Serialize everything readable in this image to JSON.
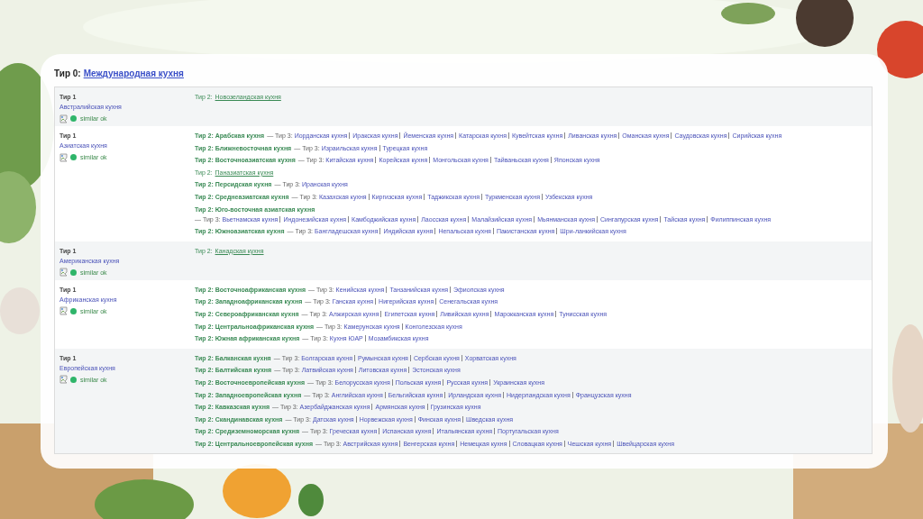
{
  "tier0": {
    "label": "Тир 0:",
    "name": "Международная кухня"
  },
  "rows": [
    {
      "tier_label": "Тир 1",
      "name": "Австралийская кухня",
      "status": "similar ok",
      "subgroups": [
        {
          "kind": "link",
          "label": "Тир 2:",
          "name": "Новозеландская кухня"
        }
      ]
    },
    {
      "tier_label": "Тир 1",
      "name": "Азиатская кухня",
      "status": "similar ok",
      "subgroups": [
        {
          "kind": "group",
          "label": "Тир 2:",
          "name": "Арабская кухня",
          "tier3_label": "— Тир 3:",
          "items": [
            "Иорданская кухня",
            "Иракская кухня",
            "Йеменская кухня",
            "Катарская кухня",
            "Кувейтская кухня",
            "Ливанская кухня",
            "Оманская кухня",
            "Саудовская кухня",
            "Сирийская кухня"
          ]
        },
        {
          "kind": "group",
          "label": "Тир 2:",
          "name": "Ближневосточная кухня",
          "tier3_label": "— Тир 3:",
          "items": [
            "Израильская кухня",
            "Турецкая кухня"
          ]
        },
        {
          "kind": "group",
          "label": "Тир 2:",
          "name": "Восточноазиатская кухня",
          "tier3_label": "— Тир 3:",
          "items": [
            "Китайская кухня",
            "Корейская кухня",
            "Монгольская кухня",
            "Тайваньская кухня",
            "Японская кухня"
          ]
        },
        {
          "kind": "link",
          "label": "Тир 2:",
          "name": "Паназиатская кухня"
        },
        {
          "kind": "group",
          "label": "Тир 2:",
          "name": "Персидская кухня",
          "tier3_label": "— Тир 3:",
          "items": [
            "Иранская кухня"
          ]
        },
        {
          "kind": "group",
          "label": "Тир 2:",
          "name": "Среднеазиатская кухня",
          "tier3_label": "— Тир 3:",
          "items": [
            "Казахская кухня",
            "Киргизская кухня",
            "Таджикская кухня",
            "Туркменская кухня",
            "Узбекская кухня"
          ]
        },
        {
          "kind": "group",
          "label": "Тир 2:",
          "name": "Юго-восточная азиатская кухня",
          "tier3_label": "— Тир 3:",
          "items": [
            "Вьетнамская кухня",
            "Индонезийская кухня",
            "Камбоджийская кухня",
            "Лаосская кухня",
            "Малайзийская кухня",
            "Мьянманская кухня",
            "Сингапурская кухня",
            "Тайская кухня",
            "Филиппинская кухня"
          ]
        },
        {
          "kind": "group",
          "label": "Тир 2:",
          "name": "Южноазиатская кухня",
          "tier3_label": "— Тир 3:",
          "items": [
            "Бангладешская кухня",
            "Индийская кухня",
            "Непальская кухня",
            "Пакистанская кухня",
            "Шри-ланкийская кухня"
          ]
        }
      ]
    },
    {
      "tier_label": "Тир 1",
      "name": "Американская кухня",
      "status": "similar ok",
      "subgroups": [
        {
          "kind": "link",
          "label": "Тир 2:",
          "name": "Канадская кухня"
        }
      ]
    },
    {
      "tier_label": "Тир 1",
      "name": "Африканская кухня",
      "status": "similar ok",
      "subgroups": [
        {
          "kind": "group",
          "label": "Тир 2:",
          "name": "Восточноафриканская кухня",
          "tier3_label": "— Тир 3:",
          "items": [
            "Кенийская кухня",
            "Танзанийская кухня",
            "Эфиопская кухня"
          ]
        },
        {
          "kind": "group",
          "label": "Тир 2:",
          "name": "Западноафриканская кухня",
          "tier3_label": "— Тир 3:",
          "items": [
            "Ганская кухня",
            "Нигерийская кухня",
            "Сенегальская кухня"
          ]
        },
        {
          "kind": "group",
          "label": "Тир 2:",
          "name": "Североафриканская кухня",
          "tier3_label": "— Тир 3:",
          "items": [
            "Алжирская кухня",
            "Египетская кухня",
            "Ливийская кухня",
            "Марокканская кухня",
            "Тунисская кухня"
          ]
        },
        {
          "kind": "group",
          "label": "Тир 2:",
          "name": "Центральноафриканская кухня",
          "tier3_label": "— Тир 3:",
          "items": [
            "Камерунская кухня",
            "Конголезская кухня"
          ]
        },
        {
          "kind": "group",
          "label": "Тир 2:",
          "name": "Южная африканская кухня",
          "tier3_label": "— Тир 3:",
          "items": [
            "Кухня ЮАР",
            "Мозамбикская кухня"
          ]
        }
      ]
    },
    {
      "tier_label": "Тир 1",
      "name": "Европейская кухня",
      "status": "similar ok",
      "subgroups": [
        {
          "kind": "group",
          "label": "Тир 2:",
          "name": "Балканская кухня",
          "tier3_label": "— Тир 3:",
          "items": [
            "Болгарская кухня",
            "Румынская кухня",
            "Сербская кухня",
            "Хорватская кухня"
          ]
        },
        {
          "kind": "group",
          "label": "Тир 2:",
          "name": "Балтийская кухня",
          "tier3_label": "— Тир 3:",
          "items": [
            "Латвийская кухня",
            "Литовская кухня",
            "Эстонская кухня"
          ]
        },
        {
          "kind": "group",
          "label": "Тир 2:",
          "name": "Восточноевропейская кухня",
          "tier3_label": "— Тир 3:",
          "items": [
            "Белорусская кухня",
            "Польская кухня",
            "Русская кухня",
            "Украинская кухня"
          ]
        },
        {
          "kind": "group",
          "label": "Тир 2:",
          "name": "Западноевропейская кухня",
          "tier3_label": "— Тир 3:",
          "items": [
            "Английская кухня",
            "Бельгийская кухня",
            "Ирландская кухня",
            "Нидерландская кухня",
            "Французская кухня"
          ]
        },
        {
          "kind": "group",
          "label": "Тир 2:",
          "name": "Кавказская кухня",
          "tier3_label": "— Тир 3:",
          "items": [
            "Азербайджанская кухня",
            "Армянская кухня",
            "Грузинская кухня"
          ]
        },
        {
          "kind": "group",
          "label": "Тир 2:",
          "name": "Скандинавская кухня",
          "tier3_label": "— Тир 3:",
          "items": [
            "Датская кухня",
            "Норвежская кухня",
            "Финская кухня",
            "Шведская кухня"
          ]
        },
        {
          "kind": "group",
          "label": "Тир 2:",
          "name": "Средиземноморская кухня",
          "tier3_label": "— Тир 3:",
          "items": [
            "Греческая кухня",
            "Испанская кухня",
            "Итальянская кухня",
            "Португальская кухня"
          ]
        },
        {
          "kind": "group",
          "label": "Тир 2:",
          "name": "Центральноевропейская кухня",
          "tier3_label": "— Тир 3:",
          "items": [
            "Австрийская кухня",
            "Венгерская кухня",
            "Немецкая кухня",
            "Словацкая кухня",
            "Чешская кухня",
            "Швейцарская кухня"
          ]
        }
      ]
    }
  ]
}
